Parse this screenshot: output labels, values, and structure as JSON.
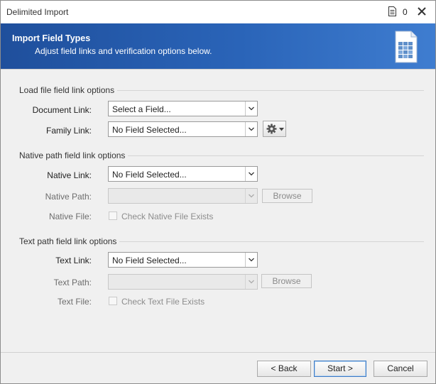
{
  "window": {
    "title": "Delimited Import",
    "doc_count": "0"
  },
  "banner": {
    "title": "Import Field Types",
    "subtitle": "Adjust field links and verification options below."
  },
  "load_file": {
    "group_label": "Load file field link options",
    "document_link": {
      "label": "Document Link:",
      "value": "Select a Field..."
    },
    "family_link": {
      "label": "Family Link:",
      "value": "No Field Selected..."
    }
  },
  "native_path": {
    "group_label": "Native path field link options",
    "native_link": {
      "label": "Native Link:",
      "value": "No Field Selected..."
    },
    "native_path": {
      "label": "Native Path:",
      "value": "",
      "browse": "Browse"
    },
    "native_file": {
      "label": "Native File:",
      "checkbox_label": "Check Native File Exists",
      "checked": false
    }
  },
  "text_path": {
    "group_label": "Text path field link options",
    "text_link": {
      "label": "Text Link:",
      "value": "No Field Selected..."
    },
    "text_path": {
      "label": "Text Path:",
      "value": "",
      "browse": "Browse"
    },
    "text_file": {
      "label": "Text File:",
      "checkbox_label": "Check Text File Exists",
      "checked": false
    }
  },
  "footer": {
    "back": "< Back",
    "start": "Start >",
    "cancel": "Cancel"
  },
  "colors": {
    "banner_start": "#1f4f9c",
    "banner_end": "#3f7dd0",
    "primary_border": "#3b79c4"
  },
  "icons": {
    "doc": "document-icon",
    "close": "close-icon",
    "banner": "table-grid-icon",
    "gear": "gear-icon"
  }
}
